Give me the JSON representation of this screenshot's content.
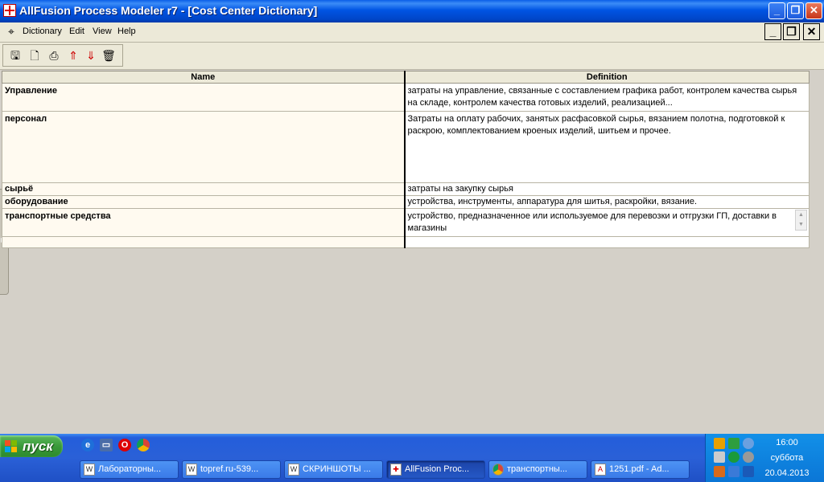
{
  "window": {
    "title": "AllFusion Process Modeler r7 - [Cost Center Dictionary]"
  },
  "menu": {
    "items": [
      "Dictionary",
      "Edit",
      "View",
      "Help"
    ]
  },
  "toolbar": {
    "buttons": [
      "save-icon",
      "print-preview-icon",
      "print-icon",
      "export-icon",
      "import-icon",
      "delete-icon"
    ]
  },
  "grid": {
    "columns": [
      "Name",
      "Definition"
    ],
    "rows": [
      {
        "name": "Управление",
        "definition": "затраты на управление, связанные с составлением графика работ, контролем качества сырья на складе, контролем качества готовых изделий, реализацией..."
      },
      {
        "name": "персонал",
        "definition": "Затраты на оплату рабочих, занятых расфасовкой сырья, вязанием полотна, подготовкой к раскрою, комплектованием кроеных изделий, шитьем и прочее."
      },
      {
        "name": "сырьё",
        "definition": "затраты на закупку сырья"
      },
      {
        "name": "оборудование",
        "definition": "устройства, инструменты, аппаратура для шитья, раскройки, вязание."
      },
      {
        "name": "транспортные средства",
        "definition": " устройство, предназначенное или используемое для перевозки и отгрузки ГП, доставки в магазины"
      },
      {
        "name": "",
        "definition": ""
      }
    ]
  },
  "taskbar": {
    "start_label": "пуск",
    "tasks": [
      "Лабораторны...",
      "topref.ru-539...",
      "СКРИНШОТЫ ...",
      "AllFusion Proc...",
      "транспортны...",
      "1251.pdf - Ad..."
    ],
    "time": "16:00",
    "day": "суббота",
    "date": "20.04.2013"
  },
  "colors": {
    "titlebar": "#0054e3",
    "name_cell_bg": "#fffaf0",
    "taskbar": "#245edb"
  }
}
